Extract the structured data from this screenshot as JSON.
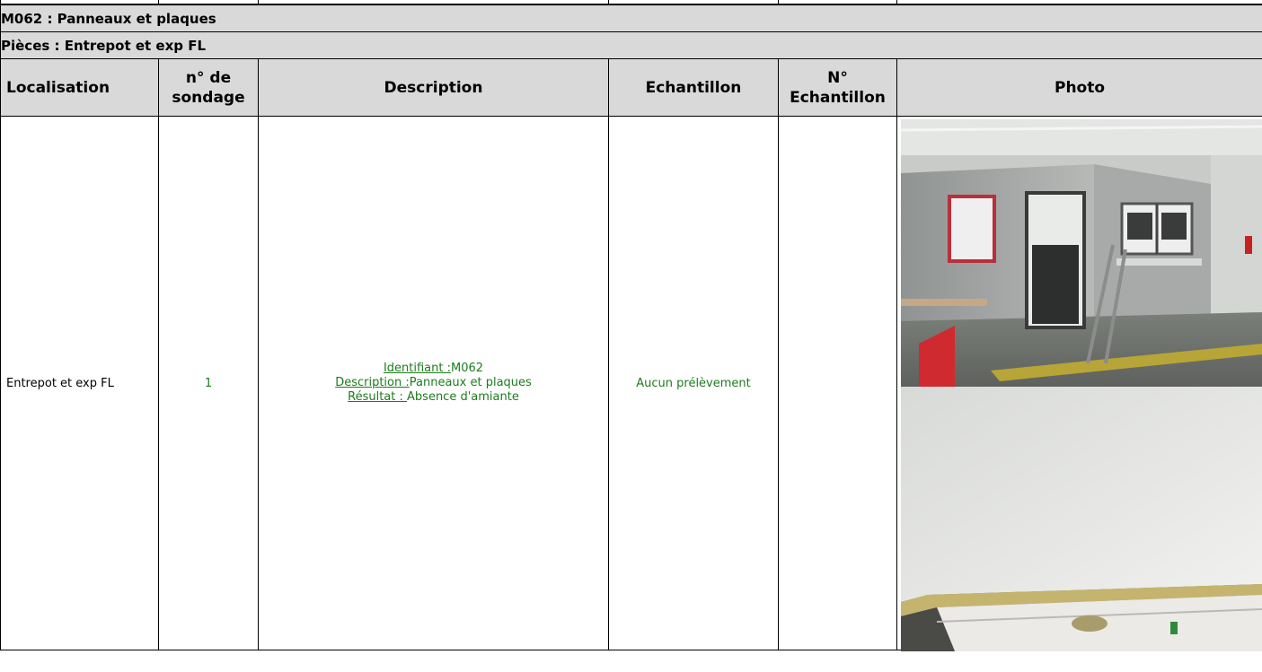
{
  "section": {
    "title": "M062 : Panneaux et plaques",
    "subtitle": "Pièces : Entrepot et exp FL"
  },
  "columns": {
    "localisation": "Localisation",
    "sondage_1": "n° de",
    "sondage_2": "sondage",
    "description": "Description",
    "echantillon": "Echantillon",
    "num_echantillon_1": "N°",
    "num_echantillon_2": "Echantillon",
    "photo": "Photo"
  },
  "rows": [
    {
      "localisation": "Entrepot et exp FL",
      "sondage": "1",
      "identifiant_label": "Identifiant :",
      "identifiant_value": "M062",
      "description_label": "Description :",
      "description_value": "Panneaux et plaques",
      "resultat_label": "Résultat : ",
      "resultat_value": " Absence d'amiante",
      "echantillon": "Aucun prélèvement",
      "num_echantillon": ""
    }
  ],
  "colors": {
    "header_bg": "#d9d9d9",
    "data_text": "#1b7d1b"
  }
}
